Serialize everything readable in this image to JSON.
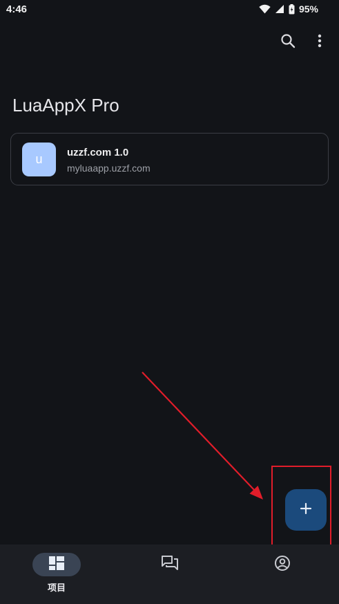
{
  "status_bar": {
    "time": "4:46",
    "battery": "95%",
    "icons": [
      "wifi-icon",
      "signal-icon",
      "battery-icon"
    ]
  },
  "toolbar": {
    "icons": [
      "search-icon",
      "more-vert-icon"
    ]
  },
  "app": {
    "title": "LuaAppX Pro"
  },
  "projects": [
    {
      "avatar_letter": "u",
      "name": "uzzf.com 1.0",
      "package": "myluaapp.uzzf.com",
      "avatar_color": "#a8c9ff"
    }
  ],
  "fab": {
    "icon": "plus-icon",
    "color": "#1b4a7c"
  },
  "bottom_nav": {
    "items": [
      {
        "label": "项目",
        "icon": "dashboard-icon",
        "selected": true
      },
      {
        "label": "",
        "icon": "forum-icon",
        "selected": false
      },
      {
        "label": "",
        "icon": "account-circle-icon",
        "selected": false
      }
    ]
  },
  "annotation": {
    "color": "#e11d2a"
  }
}
